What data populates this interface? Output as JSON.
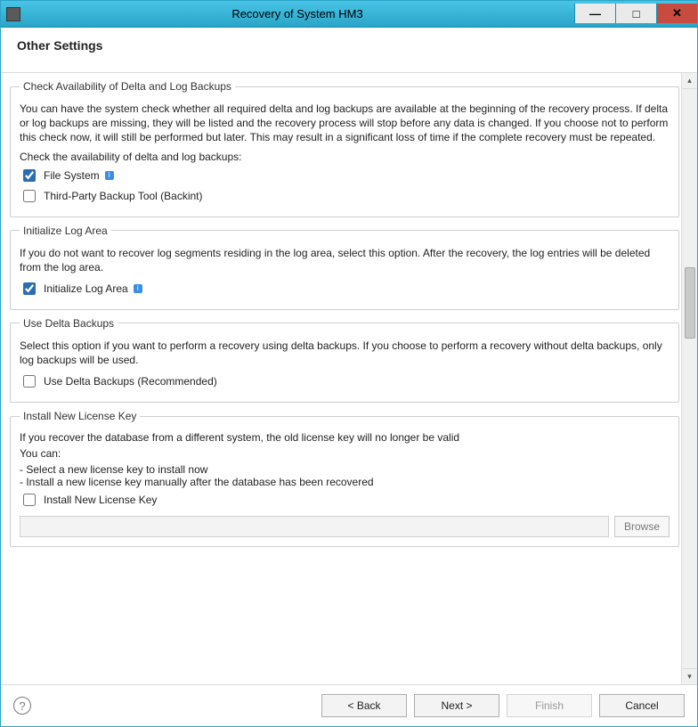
{
  "window": {
    "title": "Recovery of System HM3"
  },
  "header": {
    "title": "Other Settings"
  },
  "groups": {
    "check_avail": {
      "legend": "Check Availability of Delta and Log Backups",
      "desc": "You can have the system check whether all required delta and log backups are available at the beginning of the recovery process. If delta or log backups are missing, they will be listed and the recovery process will stop before any data is changed. If you choose not to perform this check now, it will still be performed but later. This may result in a significant loss of time if the complete recovery must be repeated.",
      "sublabel": "Check the availability of delta and log backups:",
      "file_system_label": "File System",
      "file_system_checked": true,
      "thirdparty_label": "Third-Party Backup Tool (Backint)",
      "thirdparty_checked": false
    },
    "init_log": {
      "legend": "Initialize Log Area",
      "desc": "If you do not want to recover log segments residing in the log area, select this option. After the recovery, the log entries will be deleted from the log area.",
      "checkbox_label": "Initialize Log Area",
      "checked": true
    },
    "delta": {
      "legend": "Use Delta Backups",
      "desc": "Select this option if you want to perform a recovery using delta backups. If you choose to perform a recovery without delta backups, only log backups will be used.",
      "checkbox_label": "Use Delta Backups (Recommended)",
      "checked": false
    },
    "license": {
      "legend": "Install New License Key",
      "line1": "If you recover the database from a different system, the old license key will no longer be valid",
      "line2": "You can:",
      "bullet1": "Select a new license key to install now",
      "bullet2": "Install a new license key manually after the database has been recovered",
      "checkbox_label": "Install New License Key",
      "checked": false,
      "path_value": "",
      "browse_label": "Browse"
    }
  },
  "footer": {
    "back_label": "< Back",
    "next_label": "Next >",
    "finish_label": "Finish",
    "cancel_label": "Cancel"
  }
}
